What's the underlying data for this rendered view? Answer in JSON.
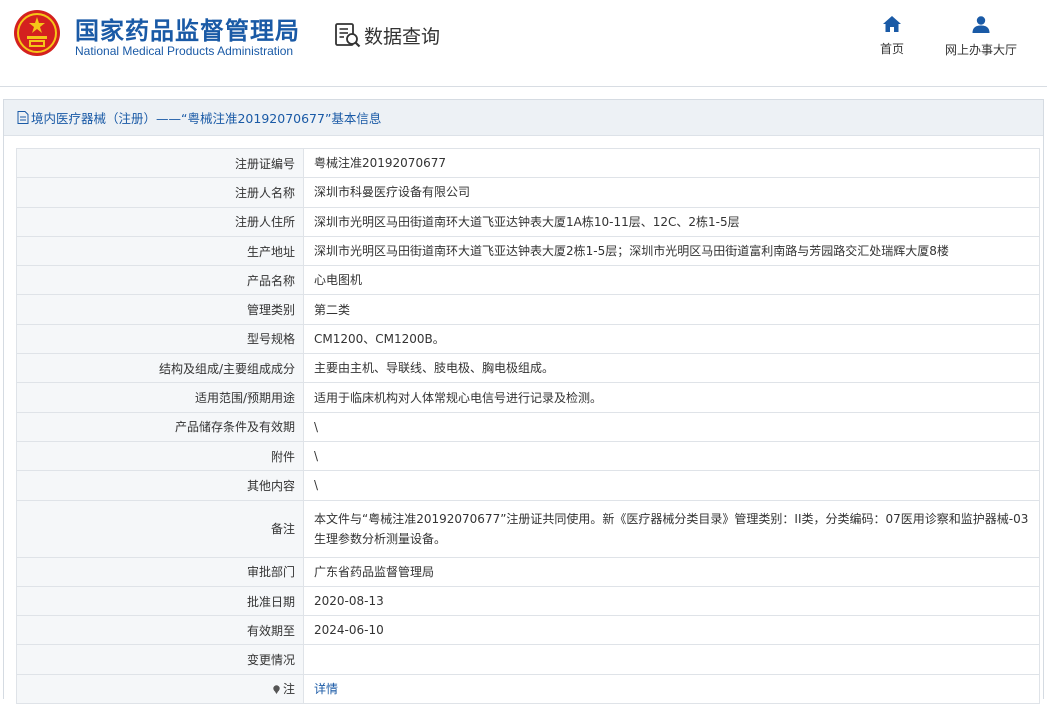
{
  "header": {
    "title_cn": "国家药品监督管理局",
    "title_en": "National Medical Products Administration",
    "query_label": "数据查询",
    "nav": {
      "home_label": "首页",
      "hall_label": "网上办事大厅"
    }
  },
  "panel": {
    "title": "境内医疗器械（注册）——“粤械注准20192070677”基本信息"
  },
  "record": {
    "rows": [
      {
        "label": "注册证编号",
        "value": "粤械注准20192070677"
      },
      {
        "label": "注册人名称",
        "value": "深圳市科曼医疗设备有限公司"
      },
      {
        "label": "注册人住所",
        "value": "深圳市光明区马田街道南环大道飞亚达钟表大厦1A栋10-11层、12C、2栋1-5层"
      },
      {
        "label": "生产地址",
        "value": "深圳市光明区马田街道南环大道飞亚达钟表大厦2栋1-5层；深圳市光明区马田街道富利南路与芳园路交汇处瑞辉大厦8楼"
      },
      {
        "label": "产品名称",
        "value": "心电图机"
      },
      {
        "label": "管理类别",
        "value": "第二类"
      },
      {
        "label": "型号规格",
        "value": "CM1200、CM1200B。"
      },
      {
        "label": "结构及组成/主要组成成分",
        "value": "主要由主机、导联线、肢电极、胸电极组成。"
      },
      {
        "label": "适用范围/预期用途",
        "value": "适用于临床机构对人体常规心电信号进行记录及检测。"
      },
      {
        "label": "产品储存条件及有效期",
        "value": "\\"
      },
      {
        "label": "附件",
        "value": "\\"
      },
      {
        "label": "其他内容",
        "value": "\\"
      },
      {
        "label": "备注",
        "value": "本文件与“粤械注准20192070677”注册证共同使用。新《医疗器械分类目录》管理类别：II类，分类编码：07医用诊察和监护器械-03生理参数分析测量设备。"
      },
      {
        "label": "审批部门",
        "value": "广东省药品监督管理局"
      },
      {
        "label": "批准日期",
        "value": "2020-08-13"
      },
      {
        "label": "有效期至",
        "value": "2024-06-10"
      },
      {
        "label": "变更情况",
        "value": ""
      }
    ],
    "note": {
      "label": "注",
      "link_text": "详情"
    }
  },
  "colors": {
    "brand_blue": "#1a5aa6",
    "emblem_red": "#d4201f",
    "emblem_gold": "#f5c518"
  },
  "icons": {
    "emblem": "national-emblem-icon",
    "query": "data-query-icon",
    "home": "home-icon",
    "user": "user-icon",
    "title": "document-icon",
    "note": "pin-dot-icon"
  }
}
